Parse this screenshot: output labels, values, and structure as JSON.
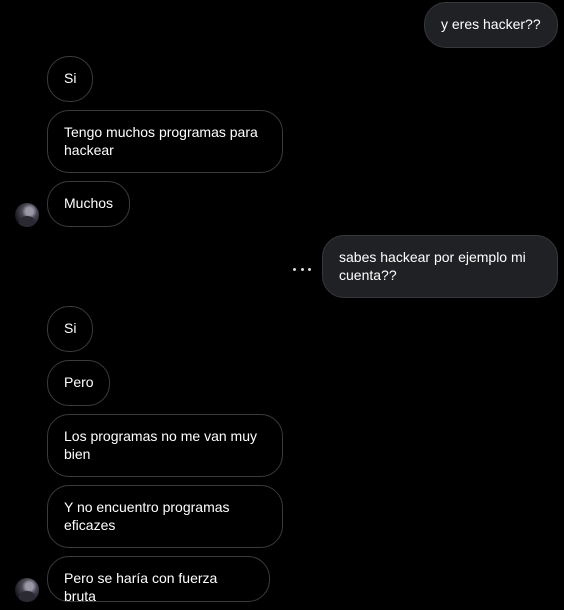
{
  "messages": [
    {
      "from": "me",
      "text": "y eres hacker??"
    },
    {
      "from": "them",
      "text": "Si"
    },
    {
      "from": "them",
      "text": "Tengo muchos programas para hackear"
    },
    {
      "from": "them",
      "text": "Muchos"
    },
    {
      "from": "me",
      "text": "sabes hackear por ejemplo mi cuenta??"
    },
    {
      "from": "them",
      "text": "Si"
    },
    {
      "from": "them",
      "text": "Pero"
    },
    {
      "from": "them",
      "text": "Los programas no me van muy bien"
    },
    {
      "from": "them",
      "text": "Y no encuentro programas eficazes"
    },
    {
      "from": "them",
      "text": "Pero se haría con fuerza bruta"
    }
  ],
  "icons": {
    "more_options": "ellipsis-icon",
    "avatar": "contact-avatar"
  },
  "colors": {
    "background": "#000000",
    "outgoing_bubble": "#1f2124",
    "incoming_border": "#3a3b3e"
  }
}
